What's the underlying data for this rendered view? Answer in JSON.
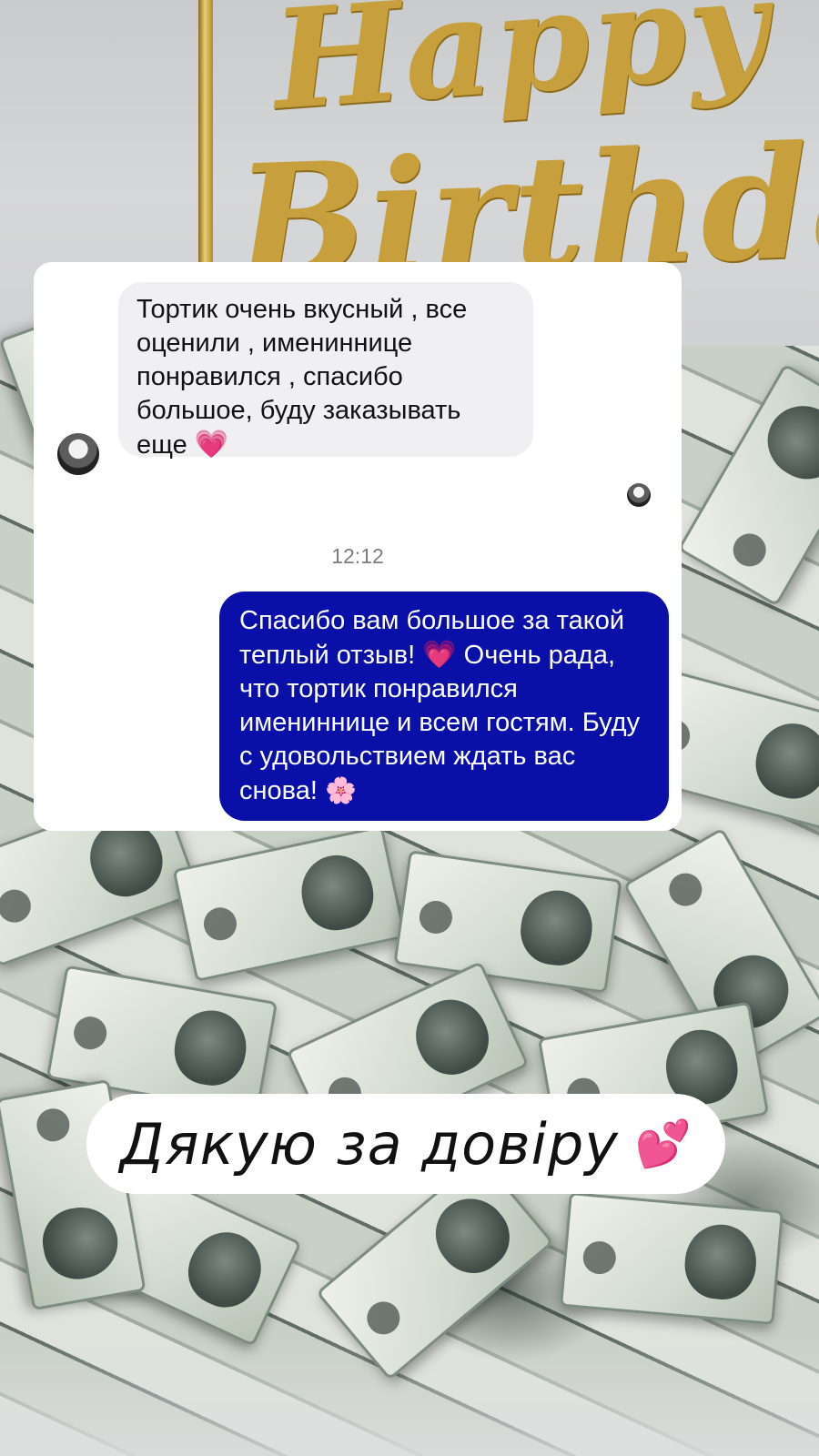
{
  "background": {
    "topper_line_1": "Happy",
    "topper_line_2": "Birthday"
  },
  "chat": {
    "incoming": {
      "text": "Тортик очень вкусный , все оценили , имениннице понравился , спасибо большое, буду заказывать еще",
      "emoji": "💗"
    },
    "timestamp": "12:12",
    "outgoing": {
      "text_1": "Спасибо вам большое за такой теплый отзыв!",
      "emoji_1": "💗",
      "text_2": "Очень рада, что тортик понравился имениннице и всем гостям. Буду с удовольствием ждать вас снова!",
      "emoji_2": "🌸"
    }
  },
  "caption": {
    "text": "Дякую за довіру",
    "emoji": "💕"
  },
  "colors": {
    "outgoing_bubble": "#0a0fa8",
    "incoming_bubble": "#f0f0f3",
    "heart": "#ff3fa3",
    "topper_gold": "#c7a03d"
  }
}
